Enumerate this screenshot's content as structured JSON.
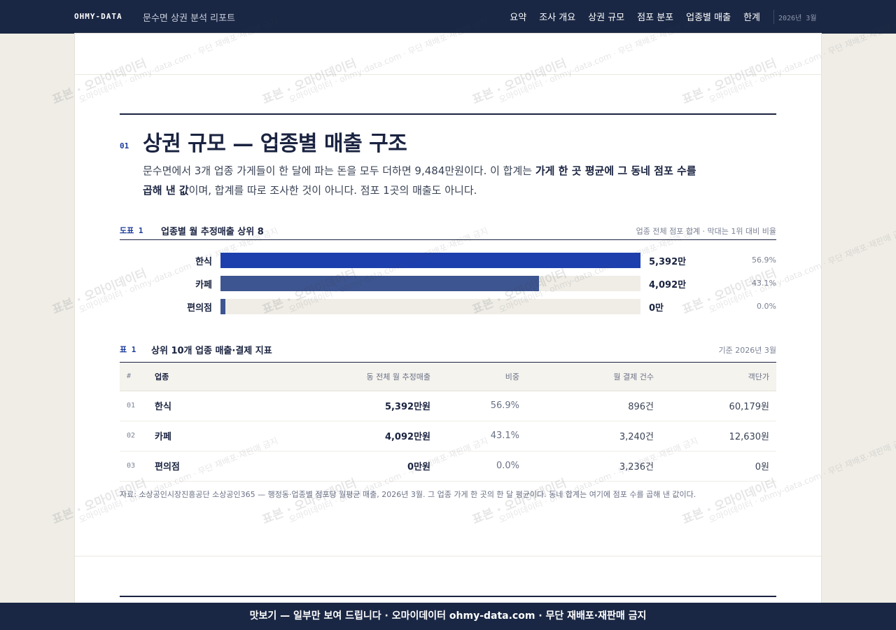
{
  "nav": {
    "brand": "OHMY-DATA",
    "report_title": "문수면 상권 분석 리포트",
    "links": [
      "요약",
      "조사 개요",
      "상권 규모",
      "점포 분포",
      "업종별 매출",
      "한계"
    ],
    "date": "2026년 3월"
  },
  "section": {
    "number": "01",
    "title": "상권 규모 — 업종별 매출 구조",
    "desc_part1": "문수면에서 3개 업종 가게들이 한 달에 파는 돈을 모두 더하면 9,484만원이다. 이 합계는 ",
    "desc_bold": "가게 한 곳 평균에 그 동네 점포 수를 곱해 낸 값",
    "desc_part2": "이며, 합계를 따로 조사한 것이 아니다. 점포 1곳의 매출도 아니다."
  },
  "figure": {
    "label": "도표 1",
    "title": "업종별 월 추정매출 상위 8",
    "note": "업종 전체 점포 합계 · 막대는 1위 대비 비율"
  },
  "chart_data": {
    "type": "bar",
    "orientation": "horizontal",
    "categories": [
      "한식",
      "카페",
      "편의점"
    ],
    "values": [
      5392,
      4092,
      0
    ],
    "value_labels": [
      "5,392만",
      "4,092만",
      "0만"
    ],
    "share_labels": [
      "56.9%",
      "43.1%",
      "0.0%"
    ],
    "colors": [
      "#1d3fae",
      "#3d5590",
      "#3d5590"
    ],
    "xlim": [
      0,
      5392
    ]
  },
  "table": {
    "label": "표 1",
    "title": "상위 10개 업종 매출·결제 지표",
    "note": "기준 2026년 3월",
    "headers": [
      "#",
      "업종",
      "동 전체 월 추정매출",
      "비중",
      "월 결제 건수",
      "객단가"
    ],
    "rows": [
      [
        "01",
        "한식",
        "5,392만원",
        "56.9%",
        "896건",
        "60,179원"
      ],
      [
        "02",
        "카페",
        "4,092만원",
        "43.1%",
        "3,240건",
        "12,630원"
      ],
      [
        "03",
        "편의점",
        "0만원",
        "0.0%",
        "3,236건",
        "0원"
      ]
    ]
  },
  "source": "자료: 소상공인시장진흥공단 소상공인365 — 행정동·업종별 점포당 월평균 매출, 2026년 3월. 그 업종 가게 한 곳의 한 달 평균이다. 동네 합계는 여기에 점포 수를 곱해 낸 값이다.",
  "watermark": {
    "big": "표본 · 오마이데이터",
    "small": "오마이데이터 · ohmy-data.com · 무단 재배포·재판매 금지"
  },
  "banner": "맛보기 — 일부만 보여 드립니다 · 오마이데이터 ohmy-data.com · 무단 재배포·재판매 금지"
}
